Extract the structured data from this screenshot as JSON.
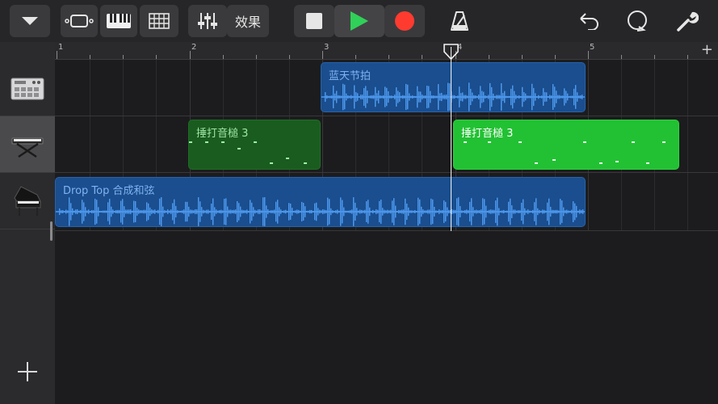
{
  "toolbar": {
    "effects_label": "效果",
    "icons": [
      "dropdown-icon",
      "view-toggle-icon",
      "keyboard-icon",
      "grid-icon",
      "mixer-icon",
      "stop-icon",
      "play-icon",
      "record-icon",
      "metronome-icon",
      "undo-icon",
      "loop-icon",
      "wrench-icon"
    ],
    "colors": {
      "play": "#30d158",
      "record": "#ff3b30",
      "stop": "#e6e6e6"
    }
  },
  "ruler": {
    "bar_numbers": [
      "1",
      "2",
      "3",
      "4",
      "5"
    ]
  },
  "tracks": [
    {
      "icon": "drum-machine-icon"
    },
    {
      "icon": "keyboard-stand-icon"
    },
    {
      "icon": "grand-piano-icon"
    }
  ],
  "regions": [
    {
      "label": "蓝天节拍",
      "kind": "audio"
    },
    {
      "label": "捶打音槌 3",
      "kind": "midi"
    },
    {
      "label": "捶打音槌 3",
      "kind": "midi"
    },
    {
      "label": "Drop Top 合成和弦",
      "kind": "audio"
    }
  ],
  "colors": {
    "audio_region": "#1a4e8e",
    "midi_region_selected": "#22c133",
    "midi_region": "#1a5c1f",
    "playhead": "#f2f2f2"
  }
}
